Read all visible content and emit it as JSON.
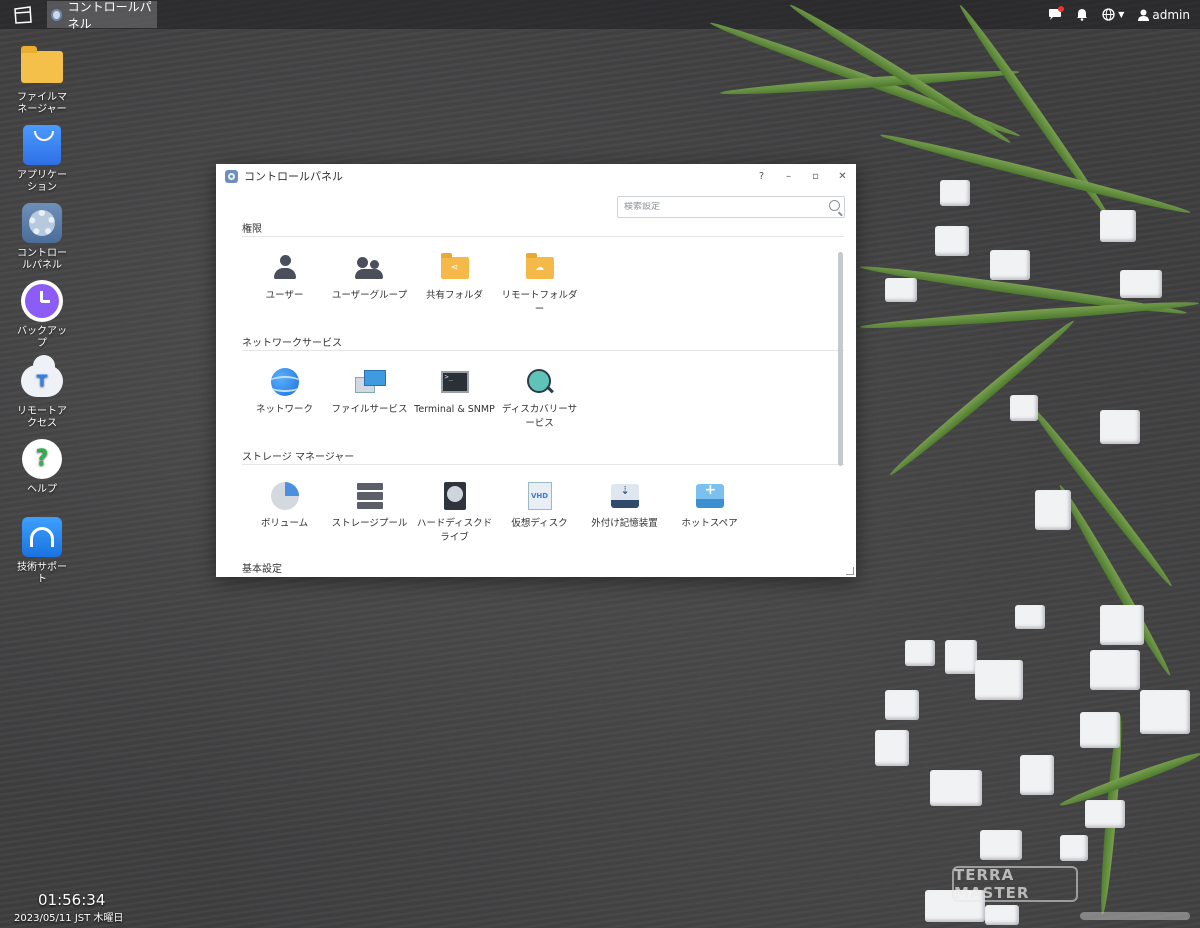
{
  "taskbar": {
    "open_tab_label": "コントロールパネル",
    "user_label": "admin"
  },
  "desktop": {
    "icons": [
      {
        "label": "ファイルマネージャー",
        "icon": "folder-icon"
      },
      {
        "label": "アプリケーション",
        "icon": "app-center-icon"
      },
      {
        "label": "コントロールパネル",
        "icon": "control-panel-icon"
      },
      {
        "label": "バックアップ",
        "icon": "backup-icon"
      },
      {
        "label": "リモートアクセス",
        "icon": "remote-access-icon"
      },
      {
        "label": "ヘルプ",
        "icon": "help-icon"
      },
      {
        "label": "技術サポート",
        "icon": "support-icon"
      }
    ],
    "clock_time": "01:56:34",
    "clock_date": "2023/05/11 JST 木曜日",
    "watermark": "TERRA MASTER"
  },
  "window": {
    "title": "コントロールパネル",
    "help_label": "?",
    "minimize_label": "–",
    "maximize_label": "▫",
    "close_label": "✕",
    "search_placeholder": "検索設定",
    "sections": [
      {
        "title": "権限",
        "items": [
          {
            "label": "ユーザー",
            "icon": "user-icon"
          },
          {
            "label": "ユーザーグループ",
            "icon": "user-group-icon"
          },
          {
            "label": "共有フォルダ",
            "icon": "shared-folder-icon"
          },
          {
            "label": "リモートフォルダー",
            "icon": "remote-folder-icon"
          }
        ]
      },
      {
        "title": "ネットワークサービス",
        "items": [
          {
            "label": "ネットワーク",
            "icon": "network-icon"
          },
          {
            "label": "ファイルサービス",
            "icon": "file-service-icon"
          },
          {
            "label": "Terminal & SNMP",
            "icon": "terminal-icon"
          },
          {
            "label": "ディスカバリーサービス",
            "icon": "discovery-icon"
          }
        ]
      },
      {
        "title": "ストレージ マネージャー",
        "items": [
          {
            "label": "ボリューム",
            "icon": "volume-icon"
          },
          {
            "label": "ストレージプール",
            "icon": "storage-pool-icon"
          },
          {
            "label": "ハードディスクドライブ",
            "icon": "hdd-icon"
          },
          {
            "label": "仮想ディスク",
            "icon": "virtual-disk-icon"
          },
          {
            "label": "外付け記憶装置",
            "icon": "external-storage-icon"
          },
          {
            "label": "ホットスペア",
            "icon": "hot-spare-icon"
          }
        ]
      },
      {
        "title": "基本設定",
        "items": []
      }
    ]
  }
}
